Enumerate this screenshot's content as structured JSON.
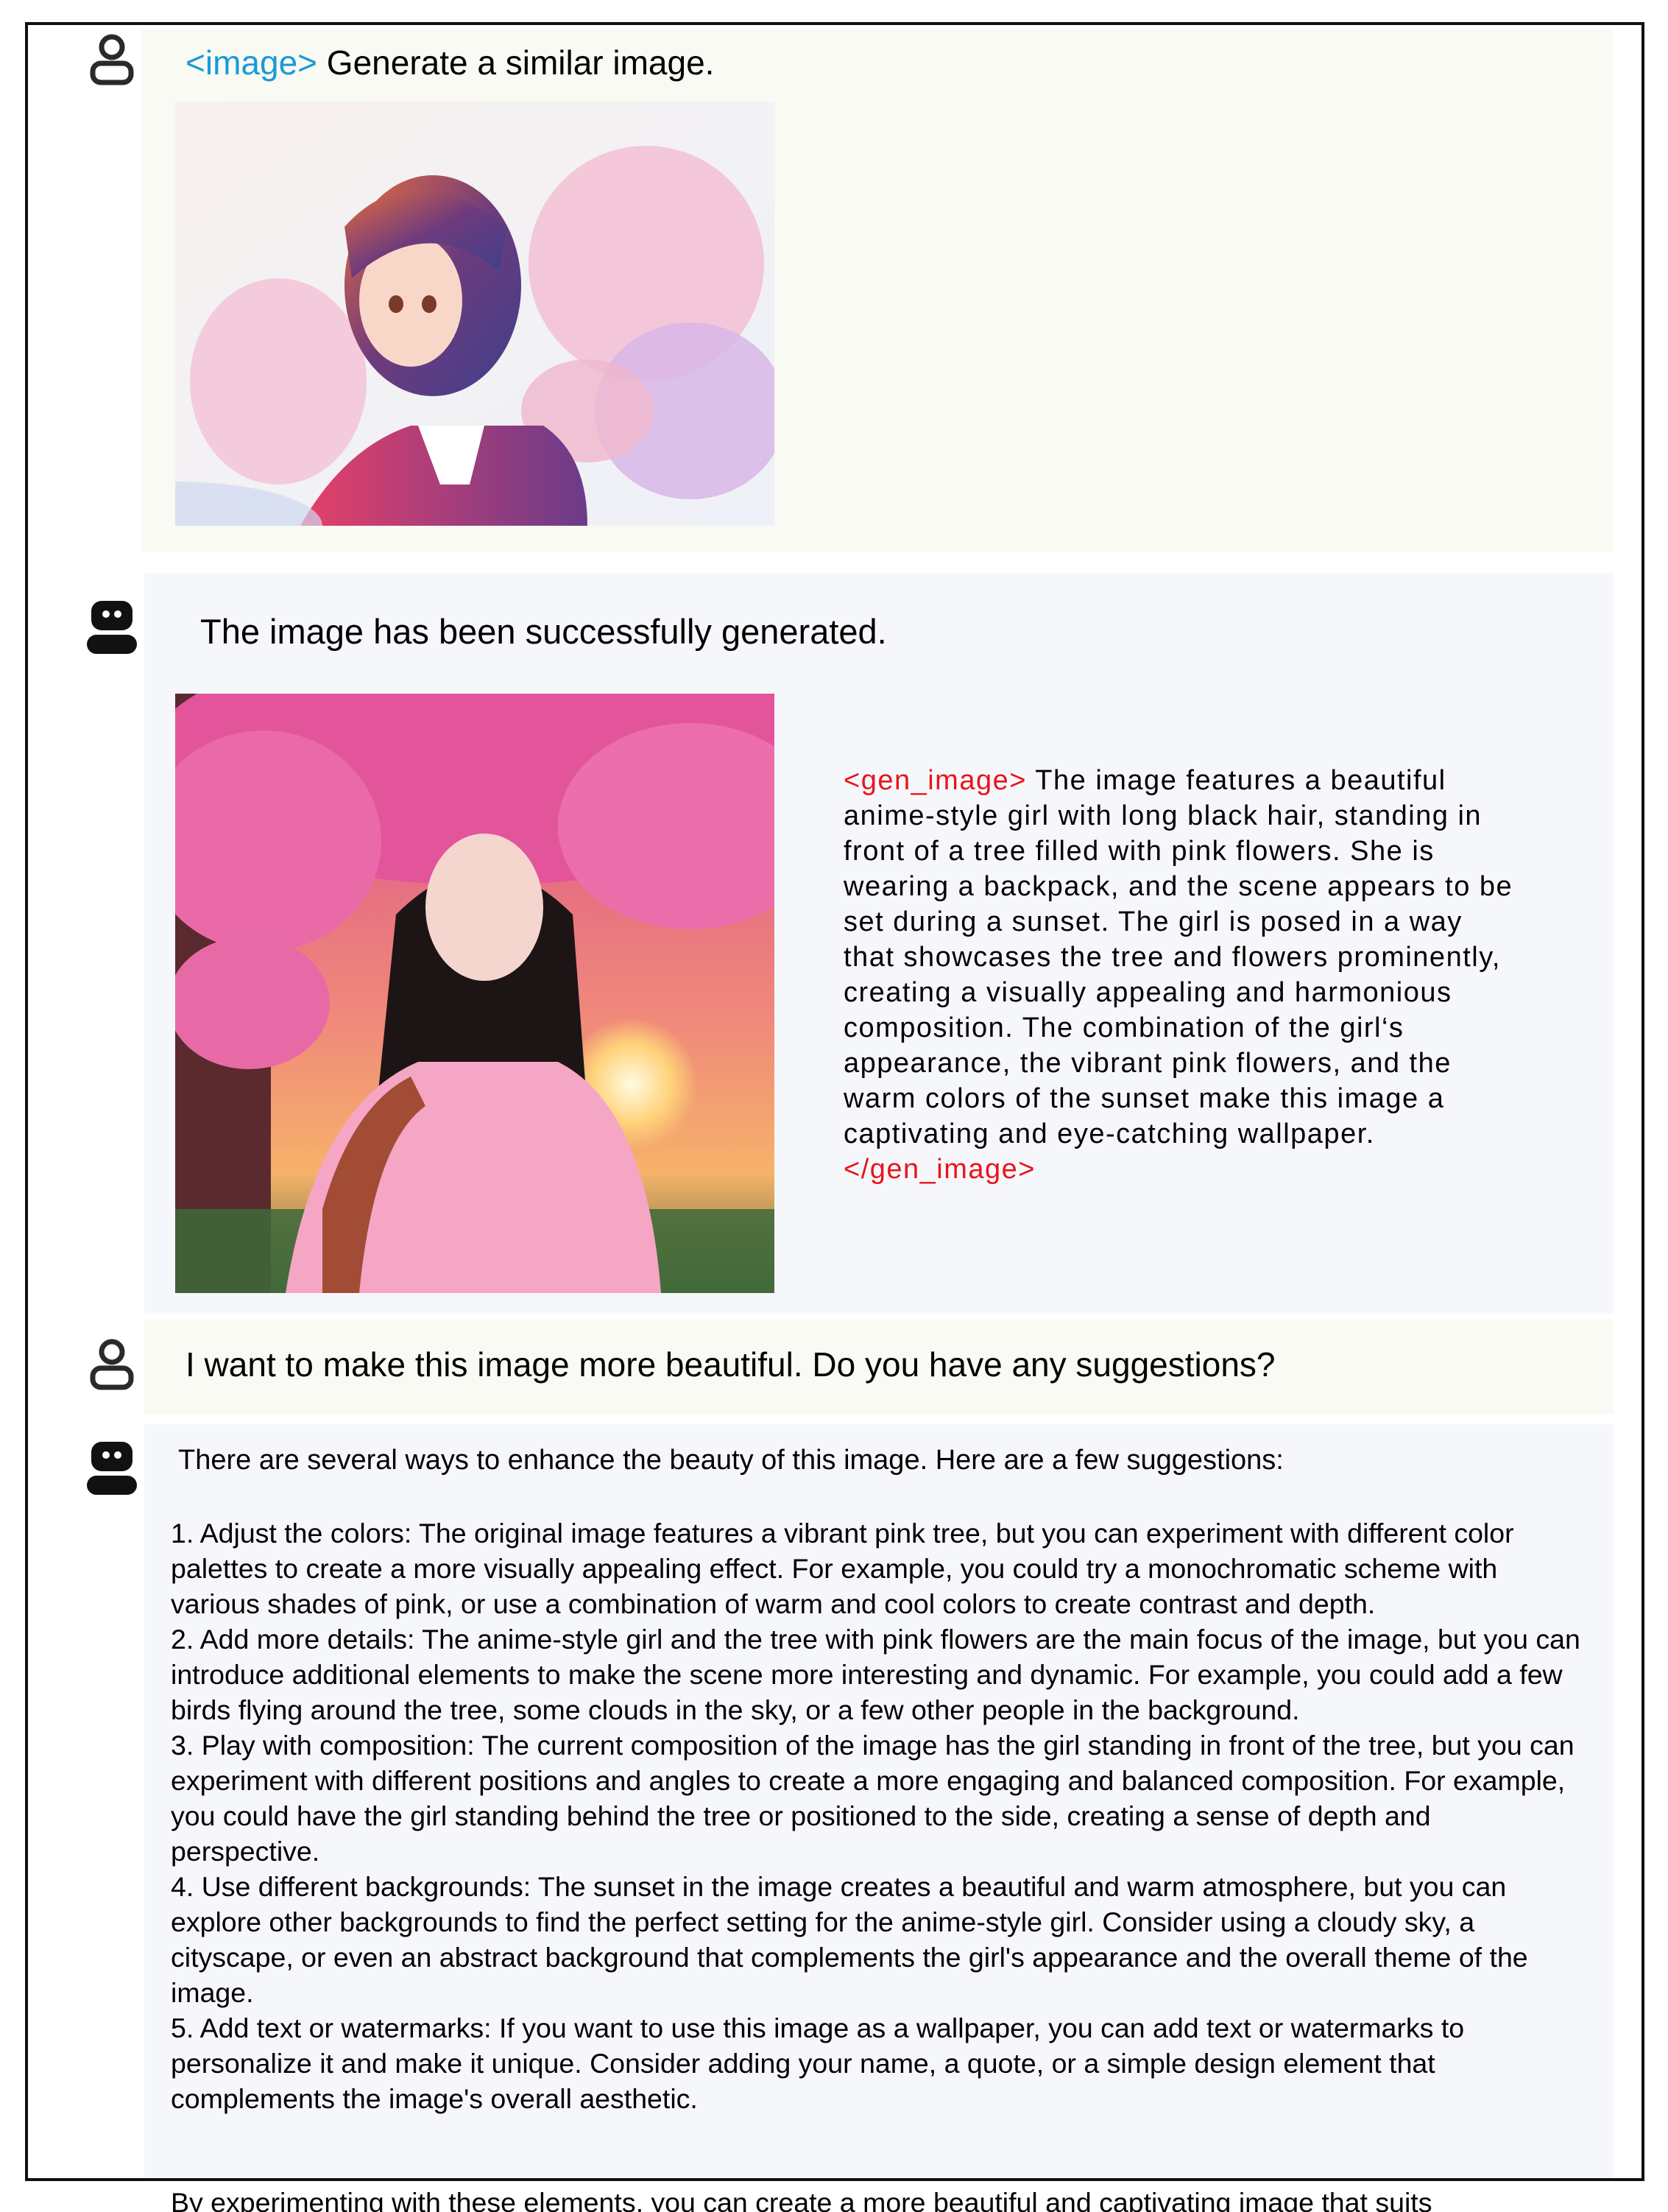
{
  "messages": [
    {
      "role": "user",
      "tag": "<image>",
      "text": " Generate a similar image."
    },
    {
      "role": "assistant",
      "text": "The image has been successfully generated.",
      "caption_open": "<gen_image>",
      "caption": " The image features a beautiful anime-style girl with long black hair, standing in front of a tree filled with pink flowers. She is wearing a backpack, and the scene appears to be set during a sunset. The girl is posed in a way that showcases the tree and flowers prominently, creating a visually appealing and harmonious composition. The combination of the girl‘s appearance, the vibrant pink flowers, and the warm colors of the sunset make this image a captivating and eye-catching wallpaper. ",
      "caption_close": "</gen_image>"
    },
    {
      "role": "user",
      "text": "I want to make this image more beautiful. Do you have any suggestions?"
    },
    {
      "role": "assistant",
      "intro": "There are several ways to enhance the beauty of this image. Here are a few suggestions:",
      "suggestions": [
        "1. Adjust the colors: The original image features a vibrant pink tree, but you can experiment with different color palettes to create a more visually appealing effect. For example, you could try a monochromatic scheme with various shades of pink, or use a combination of warm and cool colors to create contrast and depth.",
        "2. Add more details: The anime-style girl and the tree with pink flowers are the main focus of the image, but you can introduce additional elements to make the scene more interesting and dynamic. For example, you could add a few birds flying around the tree, some clouds in the sky, or a few other people in the background.",
        "3. Play with composition: The current composition of the image has the girl standing in front of the tree, but you can experiment with different positions and angles to create a more engaging and balanced composition. For example, you could have the girl standing behind the tree or positioned to the side, creating a sense of depth and perspective.",
        "4. Use different backgrounds: The sunset in the image creates a beautiful and warm atmosphere, but you can explore other backgrounds to find the perfect setting for the anime-style girl. Consider using a cloudy sky, a cityscape, or even an abstract background that complements the girl's appearance and the overall theme of the image.",
        "5. Add text or watermarks: If you want to use this image as a wallpaper, you can add text or watermarks to personalize it and make it unique. Consider adding your name, a quote, or a simple design element that complements the image's overall aesthetic."
      ],
      "closing": "By experimenting with these elements, you can create a more beautiful and captivating image that suits"
    }
  ],
  "icons": {
    "user": "user-icon",
    "assistant": "robot-icon"
  },
  "colors": {
    "tag_blue": "#1a9ad8",
    "tag_red": "#e8141c",
    "user_bubble": "#f9faf4",
    "bot_bubble": "#f6f7fb"
  }
}
